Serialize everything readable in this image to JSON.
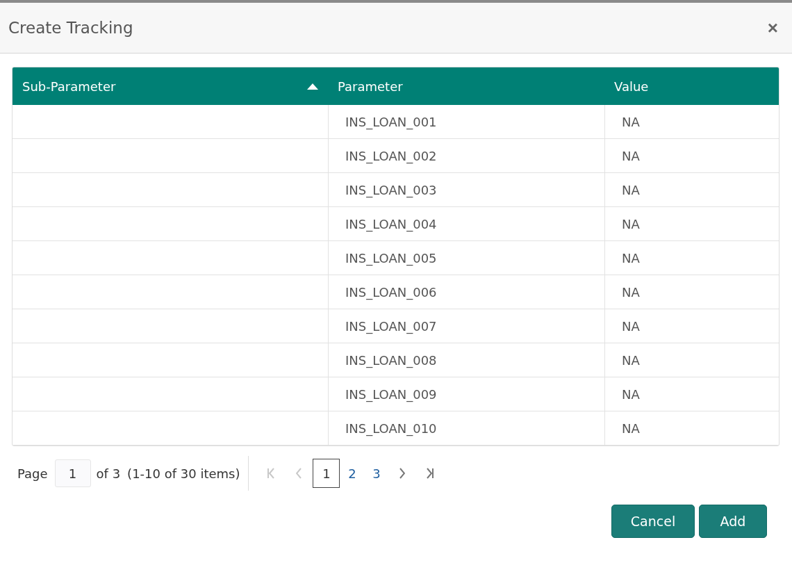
{
  "dialog": {
    "title": "Create Tracking",
    "close": "×"
  },
  "table": {
    "columns": [
      {
        "label": "Sub-Parameter",
        "sorted": true
      },
      {
        "label": "Parameter",
        "sorted": false
      },
      {
        "label": "Value",
        "sorted": false
      }
    ],
    "rows": [
      {
        "parameter": "INS_LOAN_001",
        "value": "NA"
      },
      {
        "parameter": "INS_LOAN_002",
        "value": "NA"
      },
      {
        "parameter": "INS_LOAN_003",
        "value": "NA"
      },
      {
        "parameter": "INS_LOAN_004",
        "value": "NA"
      },
      {
        "parameter": "INS_LOAN_005",
        "value": "NA"
      },
      {
        "parameter": "INS_LOAN_006",
        "value": "NA"
      },
      {
        "parameter": "INS_LOAN_007",
        "value": "NA"
      },
      {
        "parameter": "INS_LOAN_008",
        "value": "NA"
      },
      {
        "parameter": "INS_LOAN_009",
        "value": "NA"
      },
      {
        "parameter": "INS_LOAN_010",
        "value": "NA"
      }
    ]
  },
  "pager": {
    "page_label": "Page",
    "page_value": "1",
    "of_label": "of 3",
    "summary": "(1-10 of 30 items)",
    "nav_before": [
      {
        "kind": "first",
        "disabled": true
      },
      {
        "kind": "prev",
        "disabled": true
      }
    ],
    "pages": [
      {
        "label": "1",
        "selected": true
      },
      {
        "label": "2",
        "selected": false
      },
      {
        "label": "3",
        "selected": false
      }
    ],
    "nav_after": [
      {
        "kind": "next",
        "disabled": false
      },
      {
        "kind": "last",
        "disabled": false
      }
    ]
  },
  "buttons": [
    "Cancel",
    "Add"
  ]
}
